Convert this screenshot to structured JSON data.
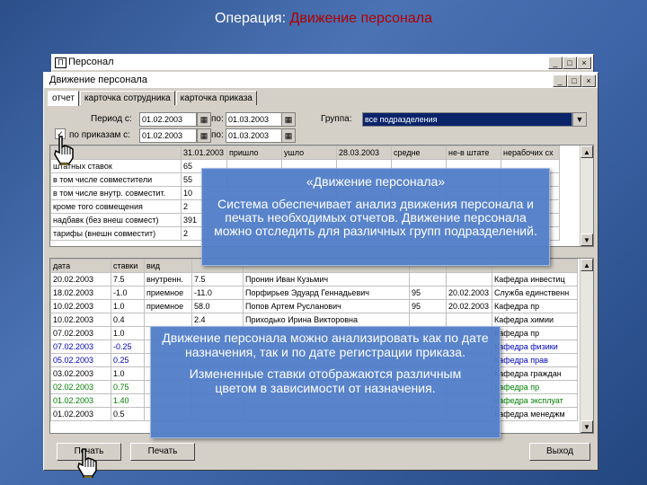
{
  "slide_title": {
    "prefix": "Операция: ",
    "highlight": "Движение персонала"
  },
  "outer_window": {
    "title": "Персонал",
    "buttons": [
      "_",
      "□",
      "×"
    ]
  },
  "inner_window": {
    "title": "Движение персонала",
    "buttons": [
      "_",
      "□",
      "×"
    ]
  },
  "tabs": [
    "отчет",
    "карточка сотрудника",
    "карточка приказа"
  ],
  "filters": {
    "period_label": "Период с:",
    "period_from": "01.02.2003",
    "to_label": "по:",
    "period_to": "01.03.2003",
    "group_label": "Группа:",
    "group_value": "все подразделения",
    "order_label": "по приказам с:",
    "order_from": "01.02.2003",
    "order_to_label": "по:",
    "order_to": "01.03.2003"
  },
  "summary_table": {
    "headers": [
      "",
      "31.01.2003",
      "пришло",
      "ушло",
      "28.03.2003",
      "средне",
      "не-в штате",
      "нерабочих сх"
    ],
    "rows": [
      [
        "штатных ставок",
        "65",
        "",
        "",
        "",
        "",
        "",
        ""
      ],
      [
        "в том числе совместители",
        "55",
        "",
        "",
        "",
        "",
        "",
        ""
      ],
      [
        "в том числе внутр. совместит.",
        "10",
        "",
        "",
        "",
        "",
        "",
        ""
      ],
      [
        "кроме того совмещения",
        "2",
        "",
        "",
        "",
        "",
        "",
        ""
      ],
      [
        "надбавк (без внеш совмест)",
        "391",
        "",
        "",
        "",
        "",
        "",
        ""
      ],
      [
        "тарифы (внешн совместит)",
        "2",
        "",
        "",
        "",
        "",
        "",
        ""
      ]
    ]
  },
  "detail_table": {
    "headers": [
      "дата",
      "ставки",
      "вид",
      "",
      "",
      "",
      "",
      ""
    ],
    "rows": [
      {
        "cls": "",
        "cells": [
          "20.02.2003",
          "7.5",
          "внутренн.",
          "7.5",
          "Пронин Иван Кузьмич",
          "",
          "",
          "Кафедра инвестиц"
        ]
      },
      {
        "cls": "",
        "cells": [
          "18.02.2003",
          "-1.0",
          "приемное",
          "-11.0",
          "Порфирьев Эдуард Геннадьевич",
          "95",
          "20.02.2003",
          "Служба единственн"
        ]
      },
      {
        "cls": "",
        "cells": [
          "10.02.2003",
          "1.0",
          "приемное",
          "58.0",
          "Попов Артем Русланович",
          "95",
          "20.02.2003",
          "Кафедра пр"
        ]
      },
      {
        "cls": "",
        "cells": [
          "10.02.2003",
          "0.4",
          "",
          "2.4",
          "Приходько Ирина Викторовна",
          "",
          "",
          "Кафедра химии"
        ]
      },
      {
        "cls": "",
        "cells": [
          "07.02.2003",
          "1.0",
          "",
          "",
          "",
          "",
          "",
          "Кафедра пр"
        ]
      },
      {
        "cls": "blue",
        "cells": [
          "07.02.2003",
          "-0.25",
          "",
          "",
          "",
          "",
          "",
          "Кафедра физики"
        ]
      },
      {
        "cls": "blue",
        "cells": [
          "05.02.2003",
          "0.25",
          "",
          "",
          "",
          "",
          "",
          "Кафедра прав"
        ]
      },
      {
        "cls": "",
        "cells": [
          "03.02.2003",
          "1.0",
          "",
          "",
          "",
          "",
          "",
          "Кафедра граждан"
        ]
      },
      {
        "cls": "green",
        "cells": [
          "02.02.2003",
          "0.75",
          "",
          "",
          "",
          "",
          "",
          "Кафедра пр"
        ]
      },
      {
        "cls": "green",
        "cells": [
          "01.02.2003",
          "1.40",
          "",
          "",
          "",
          "",
          "",
          "Кафедра эксплуат"
        ]
      },
      {
        "cls": "",
        "cells": [
          "01.02.2003",
          "0.5",
          "",
          "",
          "",
          "",
          "",
          "Кафедра менеджм"
        ]
      }
    ]
  },
  "buttons": {
    "report": "Печать",
    "print": "Печать",
    "exit": "Выход"
  },
  "callout1": {
    "title": "«Движение персонала»",
    "body": "Система обеспечивает анализ движения персонала и печать необходимых отчетов. Движение персонала можно отследить для различных групп подразделений."
  },
  "callout2": {
    "line1": "Движение персонала можно анализировать как по дате назначения, так и по дате регистрации приказа.",
    "line2": "Измененные ставки отображаются различным цветом в зависимости от назначения."
  },
  "colors": {
    "accent": "#b00000",
    "callout": "#507dc8"
  }
}
